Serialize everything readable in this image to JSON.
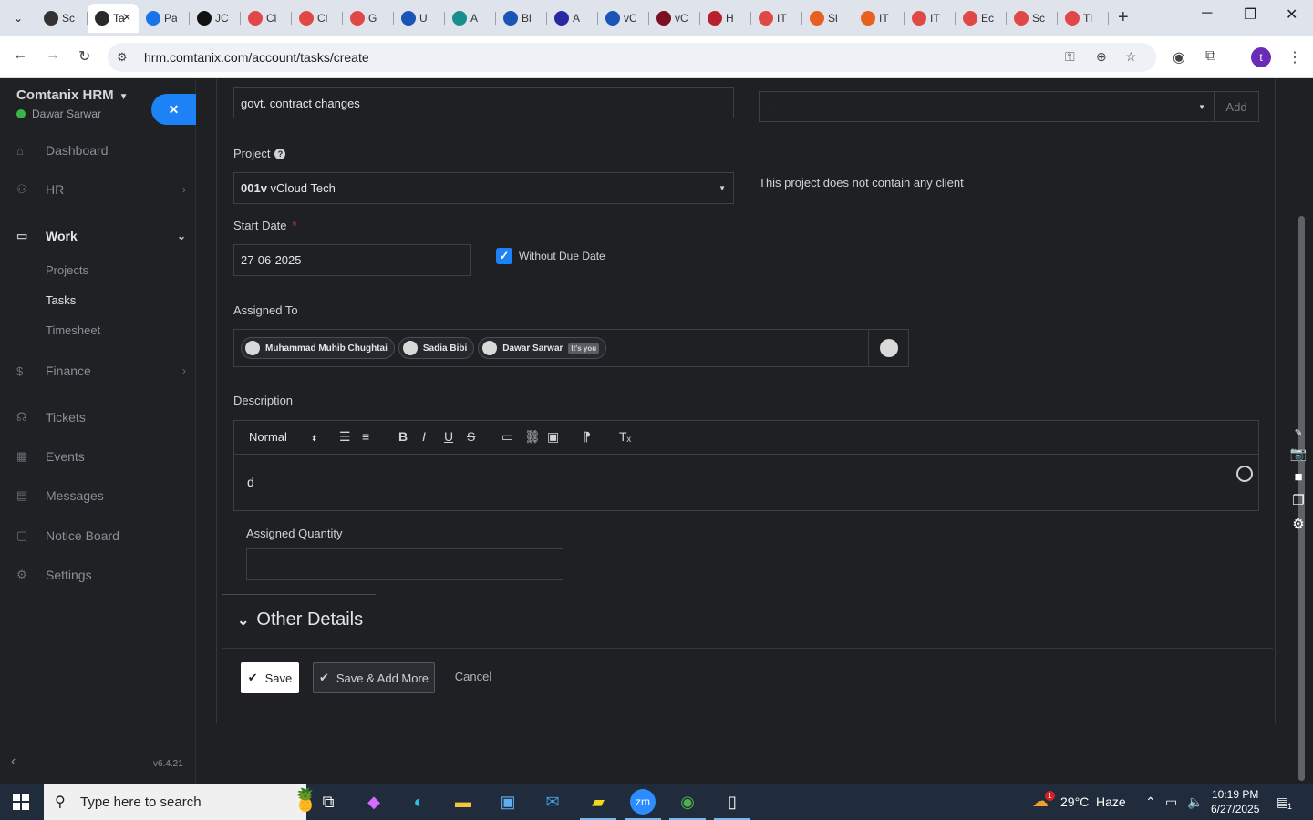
{
  "browser": {
    "tabs": [
      {
        "title": "Sc",
        "color": "#333333"
      },
      {
        "title": "Ta",
        "color": "#2a2a2a",
        "active": true
      },
      {
        "title": "Pa",
        "color": "#1a73e8"
      },
      {
        "title": "JC",
        "color": "#111111"
      },
      {
        "title": "Cl",
        "color": "#e04848"
      },
      {
        "title": "Cl",
        "color": "#e04848"
      },
      {
        "title": "G",
        "color": "#e04848"
      },
      {
        "title": "U",
        "color": "#1a55b5"
      },
      {
        "title": "A",
        "color": "#198f8f"
      },
      {
        "title": "Bl",
        "color": "#1a55b5"
      },
      {
        "title": "A",
        "color": "#2a2aa0"
      },
      {
        "title": "vC",
        "color": "#1a55b5"
      },
      {
        "title": "vC",
        "color": "#7a1020"
      },
      {
        "title": "H",
        "color": "#b82030"
      },
      {
        "title": "IT",
        "color": "#e04848"
      },
      {
        "title": "Sl",
        "color": "#e86020"
      },
      {
        "title": "IT",
        "color": "#e86020"
      },
      {
        "title": "IT",
        "color": "#e04848"
      },
      {
        "title": "Ec",
        "color": "#e04848"
      },
      {
        "title": "Sc",
        "color": "#e04848"
      },
      {
        "title": "Tl",
        "color": "#e04848"
      }
    ],
    "url": "hrm.comtanix.com/account/tasks/create",
    "profile_initial": "t"
  },
  "sidebar": {
    "brand": "Comtanix HRM",
    "user": "Dawar Sarwar",
    "items": [
      {
        "label": "Dashboard",
        "icon": "home-icon"
      },
      {
        "label": "HR",
        "icon": "users-icon",
        "has_arrow": true
      },
      {
        "label": "Work",
        "icon": "briefcase-icon",
        "open": true
      },
      {
        "label": "Finance",
        "icon": "dollar-icon",
        "has_arrow": true
      },
      {
        "label": "Tickets",
        "icon": "headset-icon"
      },
      {
        "label": "Events",
        "icon": "calendar-icon"
      },
      {
        "label": "Messages",
        "icon": "message-icon"
      },
      {
        "label": "Notice Board",
        "icon": "clipboard-icon"
      },
      {
        "label": "Settings",
        "icon": "gear-icon"
      }
    ],
    "work_sub": [
      "Projects",
      "Tasks",
      "Timesheet"
    ],
    "version": "v6.4.21"
  },
  "form": {
    "title_value": "govt. contract changes",
    "category_value": "--",
    "category_add": "Add",
    "project_label": "Project",
    "project_code": "001v",
    "project_name": "vCloud Tech",
    "project_note": "This project does not contain any client",
    "start_date_label": "Start Date",
    "start_date_required": "*",
    "start_date_value": "27-06-2025",
    "without_due_label": "Without Due Date",
    "assigned_to_label": "Assigned To",
    "assignees": [
      {
        "name": "Muhammad Muhib Chughtai"
      },
      {
        "name": "Sadia Bibi"
      },
      {
        "name": "Dawar Sarwar",
        "badge": "It's you"
      }
    ],
    "description_label": "Description",
    "editor_format": "Normal",
    "editor_text": "d",
    "assigned_quantity_label": "Assigned Quantity",
    "assigned_quantity_value": "",
    "other_details_label": "Other Details",
    "save_label": "Save",
    "save_add_label": "Save & Add More",
    "cancel_label": "Cancel"
  },
  "taskbar": {
    "search_placeholder": "Type here to search",
    "weather_temp": "29°C",
    "weather_desc": "Haze",
    "weather_badge": "1",
    "time": "10:19 PM",
    "date": "6/27/2025",
    "notification_count": "1"
  }
}
